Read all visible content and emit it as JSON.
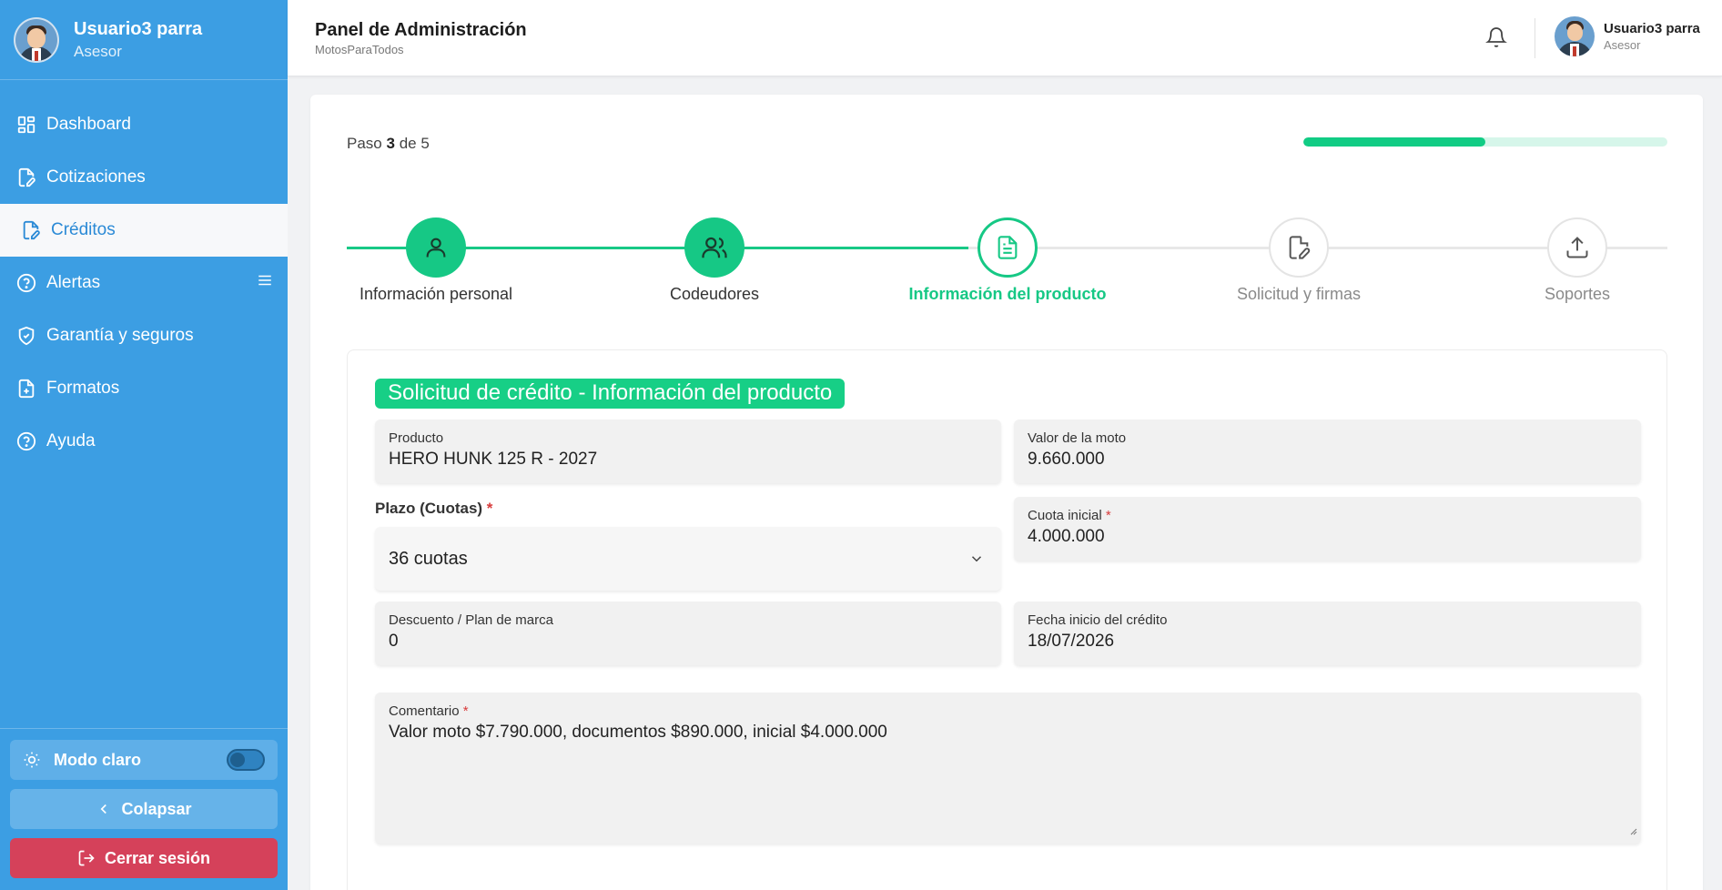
{
  "user": {
    "name": "Usuario3 parra",
    "role": "Asesor"
  },
  "sidebar": {
    "items": [
      {
        "label": "Dashboard",
        "icon": "dashboard-icon"
      },
      {
        "label": "Cotizaciones",
        "icon": "document-edit-icon"
      },
      {
        "label": "Créditos",
        "icon": "document-edit-icon",
        "active": true
      },
      {
        "label": "Alertas",
        "icon": "question-circle-icon"
      },
      {
        "label": "Garantía y seguros",
        "icon": "shield-check-icon"
      },
      {
        "label": "Formatos",
        "icon": "file-plus-icon"
      },
      {
        "label": "Ayuda",
        "icon": "question-circle-icon"
      }
    ],
    "mode_label": "Modo claro",
    "collapse_label": "Colapsar",
    "logout_label": "Cerrar sesión"
  },
  "header": {
    "title": "Panel de Administración",
    "subtitle": "MotosParaTodos"
  },
  "wizard": {
    "step_prefix": "Paso",
    "step_current": "3",
    "step_of": "de 5",
    "progress_fraction": 0.5,
    "steps": [
      {
        "label": "Información personal",
        "state": "done",
        "icon": "user-icon"
      },
      {
        "label": "Codeudores",
        "state": "done",
        "icon": "users-icon"
      },
      {
        "label": "Información del producto",
        "state": "current",
        "icon": "file-text-icon"
      },
      {
        "label": "Solicitud y firmas",
        "state": "todo",
        "icon": "signature-icon"
      },
      {
        "label": "Soportes",
        "state": "todo",
        "icon": "upload-icon"
      }
    ]
  },
  "form": {
    "section_title": "Solicitud de crédito - Información del producto",
    "producto": {
      "label": "Producto",
      "value": "HERO HUNK 125 R  - 2027"
    },
    "valor_moto": {
      "label": "Valor de la moto",
      "value": "9.660.000"
    },
    "plazo": {
      "label": "Plazo (Cuotas)",
      "required": "*",
      "value": "36 cuotas"
    },
    "cuota_inicial": {
      "label": "Cuota inicial",
      "required": "*",
      "value": "4.000.000"
    },
    "descuento": {
      "label": "Descuento / Plan de marca",
      "value": "0"
    },
    "fecha_inicio": {
      "label": "Fecha inicio del crédito",
      "value": "18/07/2026"
    },
    "comentario": {
      "label": "Comentario",
      "required": "*",
      "value": "Valor moto  $7.790.000, documentos $890.000, inicial $4.000.000"
    }
  },
  "colors": {
    "sidebar": "#3c9ee3",
    "accent": "#16c885",
    "danger": "#d5415a",
    "warning": "#f5b914"
  }
}
